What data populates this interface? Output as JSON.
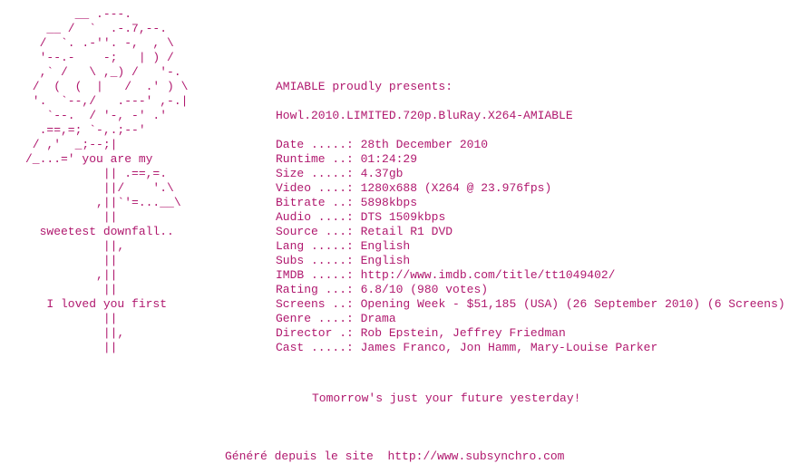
{
  "ascii_art": [
    "       __ .---.",
    "   __ /  `  .-.7,--.",
    "  /  `. .-''. -,  , \\",
    "  '--.-    -;   | ) /",
    "  ,` /   \\ ,_) /   '-.",
    " /  (  (  |   /  .' ) \\",
    " '.  `--,/   .---' ,-.|",
    "   `--.  / '-, -' .'",
    "  .==,=; `-,.;--'",
    " / ,'  _;--;|",
    "/_...=' you are my",
    "           || .==,=.",
    "           ||/    '.\\",
    "          ,||`'=...__\\",
    "           ||",
    "  sweetest downfall..",
    "           ||,",
    "           ||",
    "          ,||",
    "           ||",
    "   I loved you first",
    "           ||",
    "           ||,",
    "           ||"
  ],
  "release": {
    "presents": "AMIABLE proudly presents:",
    "name": "Howl.2010.LIMITED.720p.BluRay.X264-AMIABLE"
  },
  "info_lines": [
    {
      "label": "Date .....: ",
      "value": "28th December 2010"
    },
    {
      "label": "Runtime ..: ",
      "value": "01:24:29"
    },
    {
      "label": "Size .....: ",
      "value": "4.37gb"
    },
    {
      "label": "Video ....: ",
      "value": "1280x688 (X264 @ 23.976fps)"
    },
    {
      "label": "Bitrate ..: ",
      "value": "5898kbps"
    },
    {
      "label": "Audio ....: ",
      "value": "DTS 1509kbps"
    },
    {
      "label": "Source ...: ",
      "value": "Retail R1 DVD"
    },
    {
      "label": "Lang .....: ",
      "value": "English"
    },
    {
      "label": "Subs .....: ",
      "value": "English"
    },
    {
      "label": "IMDB .....: ",
      "value": "http://www.imdb.com/title/tt1049402/"
    },
    {
      "label": "Rating ...: ",
      "value": "6.8/10 (980 votes)"
    },
    {
      "label": "Screens ..: ",
      "value": "Opening Week - $51,185 (USA) (26 September 2010) (6 Screens)"
    },
    {
      "label": "Genre ....: ",
      "value": "Drama"
    },
    {
      "label": "Director .: ",
      "value": "Rob Epstein, Jeffrey Friedman"
    },
    {
      "label": "Cast .....: ",
      "value": "James Franco, Jon Hamm, Mary-Louise Parker"
    }
  ],
  "tagline": "Tomorrow's just your future yesterday!",
  "footer": {
    "prefix": "Généré depuis le site  ",
    "url": "http://www.subsynchro.com"
  },
  "colors": {
    "text": "#b0186e",
    "background": "#ffffff"
  }
}
